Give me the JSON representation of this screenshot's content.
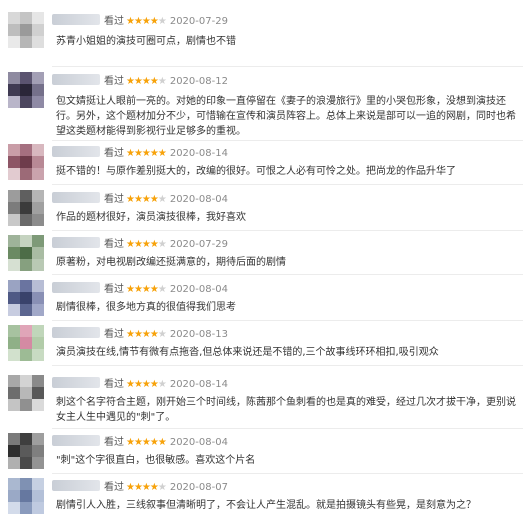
{
  "reviews": [
    {
      "seen": "看过",
      "stars": 4,
      "date": "2020-07-29",
      "text": "苏青小姐姐的演技可圈可点，剧情也不错"
    },
    {
      "seen": "看过",
      "stars": 4,
      "date": "2020-08-12",
      "text": "包文婧挺让人眼前一亮的。对她的印象一直停留在《妻子的浪漫旅行》里的小哭包形象，没想到演技还行。另外，这个题材加分不少，可惜输在宣传和演员阵容上。总体上来说是部可以一追的网剧，同时也希望这类题材能得到影视行业足够多的重视。"
    },
    {
      "seen": "看过",
      "stars": 5,
      "date": "2020-08-14",
      "text": "挺不错的！与原作差别挺大的，改编的很好。可恨之人必有可怜之处。把尚龙的作品升华了"
    },
    {
      "seen": "看过",
      "stars": 4,
      "date": "2020-08-04",
      "text": "作品的题材很好，演员演技很棒，我好喜欢"
    },
    {
      "seen": "看过",
      "stars": 4,
      "date": "2020-07-29",
      "text": "原著粉，对电视剧改编还挺满意的，期待后面的剧情"
    },
    {
      "seen": "看过",
      "stars": 4,
      "date": "2020-08-04",
      "text": "剧情很棒，很多地方真的很值得我们思考"
    },
    {
      "seen": "看过",
      "stars": 4,
      "date": "2020-08-13",
      "text": "演员演技在线,情节有微有点拖沓,但总体来说还是不错的,三个故事线环环相扣,吸引观众"
    },
    {
      "seen": "看过",
      "stars": 4,
      "date": "2020-08-14",
      "text": "刺这个名字符合主题，刚开始三个时间线，陈茜那个鱼刺看的也是真的难受，经过几次才拔干净，更别说女主人生中遇见的\"刺\"了。"
    },
    {
      "seen": "看过",
      "stars": 5,
      "date": "2020-08-04",
      "text": "\"刺\"这个字很直白，也很敏感。喜欢这个片名"
    },
    {
      "seen": "看过",
      "stars": 4,
      "date": "2020-08-07",
      "text": "剧情引人入胜，三线叙事但清晰明了，不会让人产生混乱。就是拍摄镜头有些晃，是刻意为之？"
    }
  ]
}
